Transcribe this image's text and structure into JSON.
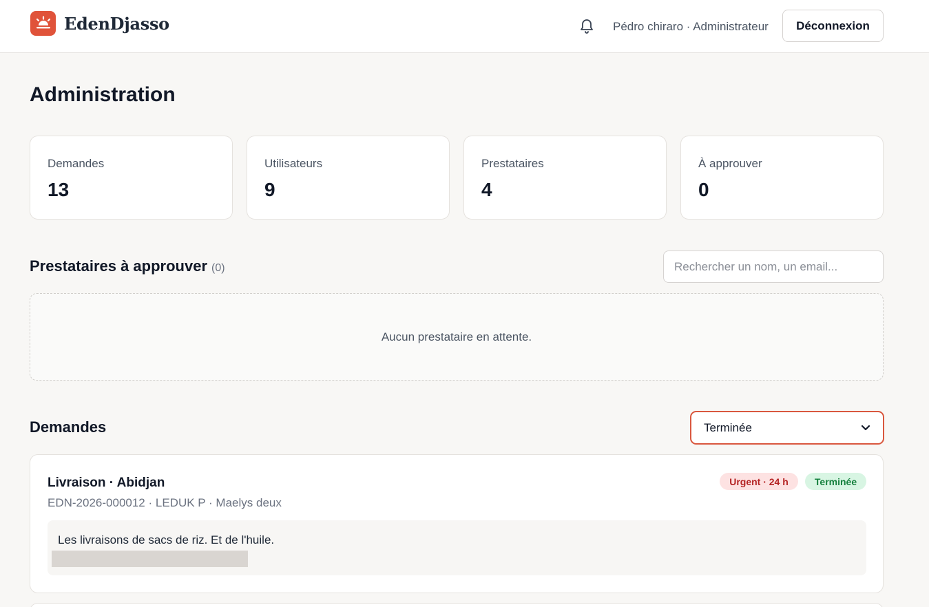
{
  "header": {
    "brand": "EdenDjasso",
    "user": "Pédro chiraro · Administrateur",
    "logout_label": "Déconnexion"
  },
  "page": {
    "title": "Administration"
  },
  "stats": [
    {
      "label": "Demandes",
      "value": "13"
    },
    {
      "label": "Utilisateurs",
      "value": "9"
    },
    {
      "label": "Prestataires",
      "value": "4"
    },
    {
      "label": "À approuver",
      "value": "0"
    }
  ],
  "pending": {
    "title": "Prestataires à approuver",
    "count": "(0)",
    "search_placeholder": "Rechercher un nom, un email...",
    "empty_text": "Aucun prestataire en attente."
  },
  "requests": {
    "title": "Demandes",
    "filter_value": "Terminée",
    "items": [
      {
        "title": "Livraison · Abidjan",
        "meta": "EDN-2026-000012 · LEDUK P · Maelys deux",
        "urgency": "Urgent · 24 h",
        "status": "Terminée",
        "description": "Les livraisons de sacs de riz. Et de l'huile."
      }
    ]
  },
  "colors": {
    "accent": "#e0533a",
    "urgent_bg": "#fde2e2",
    "urgent_text": "#b42323",
    "done_bg": "#d8f5e3",
    "done_text": "#15803d"
  }
}
